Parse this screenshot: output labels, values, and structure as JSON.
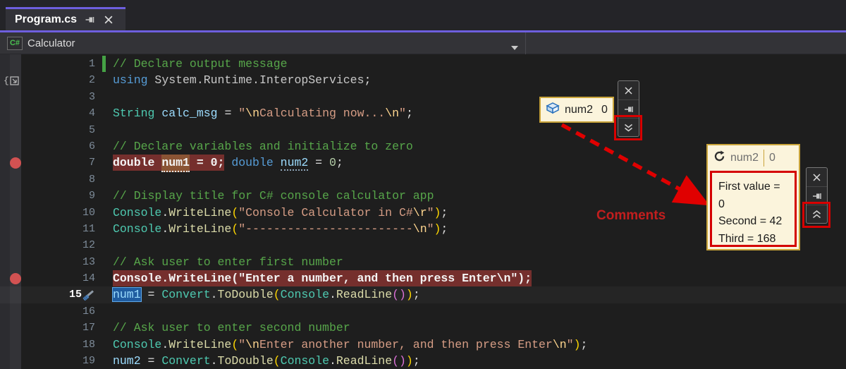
{
  "tab": {
    "label": "Program.cs"
  },
  "navbar": {
    "badge": "C#",
    "project": "Calculator"
  },
  "colors": {
    "accent_purple": "#6E5FDE",
    "breakpoint_red": "#D25252",
    "breakpoint_line_bg": "#752F2D",
    "annotation_red": "#D80000",
    "datatip_bg": "#FBF4DC",
    "datatip_border": "#C9A43A",
    "comment_green": "#57A64A"
  },
  "editor": {
    "lines": [
      {
        "n": 1,
        "change": true,
        "tokens": [
          {
            "c": "comment",
            "t": "// Declare output message"
          }
        ]
      },
      {
        "n": 2,
        "glyph": "brace",
        "tokens": [
          {
            "c": "kw",
            "t": "using"
          },
          {
            "c": "plain",
            "t": " System.Runtime.InteropServices"
          },
          {
            "c": "punct",
            "t": ";"
          }
        ]
      },
      {
        "n": 3,
        "tokens": []
      },
      {
        "n": 4,
        "tokens": [
          {
            "c": "type",
            "t": "String"
          },
          {
            "c": "plain",
            "t": " "
          },
          {
            "c": "var",
            "t": "calc_msg"
          },
          {
            "c": "punct",
            "t": " = "
          },
          {
            "c": "str",
            "t": "\""
          },
          {
            "c": "esc",
            "t": "\\n"
          },
          {
            "c": "str",
            "t": "Calculating now..."
          },
          {
            "c": "esc",
            "t": "\\n"
          },
          {
            "c": "str",
            "t": "\""
          },
          {
            "c": "punct",
            "t": ";"
          }
        ]
      },
      {
        "n": 5,
        "tokens": []
      },
      {
        "n": 6,
        "tokens": [
          {
            "c": "comment",
            "t": "// Declare variables and initialize to zero"
          }
        ]
      },
      {
        "n": 7,
        "glyph": "breakpoint",
        "tokens": [
          {
            "c": "wb redbg",
            "t": "double "
          },
          {
            "c": "wb redbg num1box",
            "t": "num1"
          },
          {
            "c": "wb redbg",
            "t": " = 0;"
          },
          {
            "c": "plain",
            "t": " "
          },
          {
            "c": "kw",
            "t": "double"
          },
          {
            "c": "plain",
            "t": " "
          },
          {
            "c": "var dotted",
            "t": "num2"
          },
          {
            "c": "punct",
            "t": " = "
          },
          {
            "c": "num",
            "t": "0"
          },
          {
            "c": "punct",
            "t": ";"
          }
        ]
      },
      {
        "n": 8,
        "tokens": []
      },
      {
        "n": 9,
        "tokens": [
          {
            "c": "comment",
            "t": "// Display title for C# console calculator app"
          }
        ]
      },
      {
        "n": 10,
        "tokens": [
          {
            "c": "type",
            "t": "Console"
          },
          {
            "c": "punct",
            "t": "."
          },
          {
            "c": "method",
            "t": "WriteLine"
          },
          {
            "c": "p1",
            "t": "("
          },
          {
            "c": "str",
            "t": "\"Console Calculator in C#"
          },
          {
            "c": "esc",
            "t": "\\r"
          },
          {
            "c": "str",
            "t": "\""
          },
          {
            "c": "p1",
            "t": ")"
          },
          {
            "c": "punct",
            "t": ";"
          }
        ]
      },
      {
        "n": 11,
        "tokens": [
          {
            "c": "type",
            "t": "Console"
          },
          {
            "c": "punct",
            "t": "."
          },
          {
            "c": "method",
            "t": "WriteLine"
          },
          {
            "c": "p1",
            "t": "("
          },
          {
            "c": "str",
            "t": "\"------------------------"
          },
          {
            "c": "esc",
            "t": "\\n"
          },
          {
            "c": "str",
            "t": "\""
          },
          {
            "c": "p1",
            "t": ")"
          },
          {
            "c": "punct",
            "t": ";"
          }
        ]
      },
      {
        "n": 12,
        "tokens": []
      },
      {
        "n": 13,
        "tokens": [
          {
            "c": "comment",
            "t": "// Ask user to enter first number"
          }
        ]
      },
      {
        "n": 14,
        "glyph": "breakpoint",
        "tokens": [
          {
            "c": "wb redbg",
            "t": "Console.WriteLine(\"Enter a number, and then press Enter\\n\");"
          }
        ]
      },
      {
        "n": 15,
        "active": true,
        "bold": true,
        "pen": true,
        "tokens": [
          {
            "c": "var selbox",
            "t": "num1"
          },
          {
            "c": "punct",
            "t": " = "
          },
          {
            "c": "type",
            "t": "Convert"
          },
          {
            "c": "punct",
            "t": "."
          },
          {
            "c": "method",
            "t": "ToDouble"
          },
          {
            "c": "p1",
            "t": "("
          },
          {
            "c": "type",
            "t": "Console"
          },
          {
            "c": "punct",
            "t": "."
          },
          {
            "c": "method",
            "t": "ReadLine"
          },
          {
            "c": "p2",
            "t": "()"
          },
          {
            "c": "p1",
            "t": ")"
          },
          {
            "c": "punct",
            "t": ";"
          }
        ]
      },
      {
        "n": 16,
        "tokens": []
      },
      {
        "n": 17,
        "tokens": [
          {
            "c": "comment",
            "t": "// Ask user to enter second number"
          }
        ]
      },
      {
        "n": 18,
        "tokens": [
          {
            "c": "type",
            "t": "Console"
          },
          {
            "c": "punct",
            "t": "."
          },
          {
            "c": "method",
            "t": "WriteLine"
          },
          {
            "c": "p1",
            "t": "("
          },
          {
            "c": "str",
            "t": "\""
          },
          {
            "c": "esc",
            "t": "\\n"
          },
          {
            "c": "str",
            "t": "Enter another number, and then press Enter"
          },
          {
            "c": "esc",
            "t": "\\n"
          },
          {
            "c": "str",
            "t": "\""
          },
          {
            "c": "p1",
            "t": ")"
          },
          {
            "c": "punct",
            "t": ";"
          }
        ]
      },
      {
        "n": 19,
        "tokens": [
          {
            "c": "var",
            "t": "num2"
          },
          {
            "c": "punct",
            "t": " = "
          },
          {
            "c": "type",
            "t": "Convert"
          },
          {
            "c": "punct",
            "t": "."
          },
          {
            "c": "method",
            "t": "ToDouble"
          },
          {
            "c": "p1",
            "t": "("
          },
          {
            "c": "type",
            "t": "Console"
          },
          {
            "c": "punct",
            "t": "."
          },
          {
            "c": "method",
            "t": "ReadLine"
          },
          {
            "c": "p2",
            "t": "()"
          },
          {
            "c": "p1",
            "t": ")"
          },
          {
            "c": "punct",
            "t": ";"
          }
        ]
      }
    ]
  },
  "datatips": [
    {
      "name": "num2",
      "value": "0",
      "icon": "field-cube-icon"
    },
    {
      "name": "num2",
      "value": "0",
      "icon": "refresh-icon",
      "comment_lines": [
        "First value = 0",
        "Second = 42",
        "Third = 168"
      ]
    }
  ],
  "annotations": {
    "comments_label": "Comments"
  }
}
